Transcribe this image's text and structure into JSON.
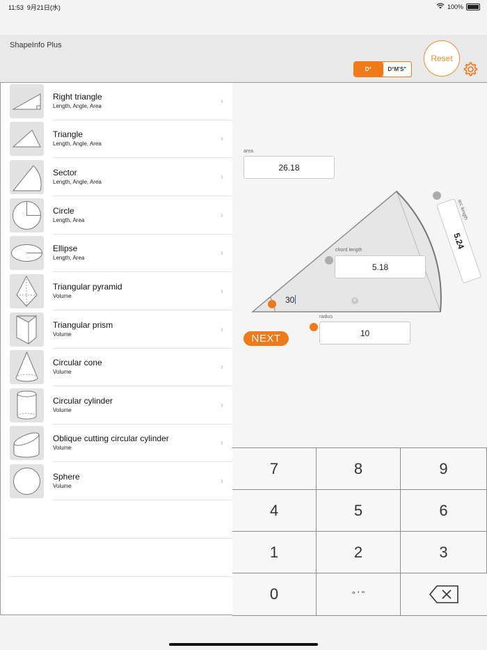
{
  "status": {
    "time": "11:53",
    "date": "9月21日(水)",
    "battery": "100%",
    "wifi_icon": "wifi-icon"
  },
  "header": {
    "title": "ShapeInfo Plus",
    "seg_degrees": "D°",
    "seg_dms": "D°M'S\"",
    "reset": "Reset",
    "settings_icon": "gear-icon",
    "accent": "#F07A1A"
  },
  "shapes": [
    {
      "title": "Right triangle",
      "sub": "Length, Angle, Area",
      "icon": "right-triangle-icon"
    },
    {
      "title": "Triangle",
      "sub": "Length, Angle, Area",
      "icon": "triangle-icon"
    },
    {
      "title": "Sector",
      "sub": "Length, Angle, Area",
      "icon": "sector-icon"
    },
    {
      "title": "Circle",
      "sub": "Length, Area",
      "icon": "circle-icon"
    },
    {
      "title": "Ellipse",
      "sub": "Length, Area",
      "icon": "ellipse-icon"
    },
    {
      "title": "Triangular pyramid",
      "sub": "Volume",
      "icon": "pyramid-icon"
    },
    {
      "title": "Triangular prism",
      "sub": "Volume",
      "icon": "prism-icon"
    },
    {
      "title": "Circular cone",
      "sub": "Volume",
      "icon": "cone-icon"
    },
    {
      "title": "Circular cylinder",
      "sub": "Volume",
      "icon": "cylinder-icon"
    },
    {
      "title": "Oblique cutting circular cylinder",
      "sub": "Volume",
      "icon": "oblique-cylinder-icon"
    },
    {
      "title": "Sphere",
      "sub": "Volume",
      "icon": "sphere-icon"
    }
  ],
  "sector": {
    "area_label": "area",
    "area": "26.18",
    "arc_label": "arc length",
    "arc": "5.24",
    "chord_label": "chord length",
    "chord": "5.18",
    "angle": "30",
    "radius_label": "radius",
    "radius": "10",
    "next": "NEXT"
  },
  "keypad": {
    "keys": [
      "7",
      "8",
      "9",
      "4",
      "5",
      "6",
      "1",
      "2",
      "3",
      "0",
      "° ' ''"
    ],
    "backspace_icon": "backspace-icon"
  }
}
